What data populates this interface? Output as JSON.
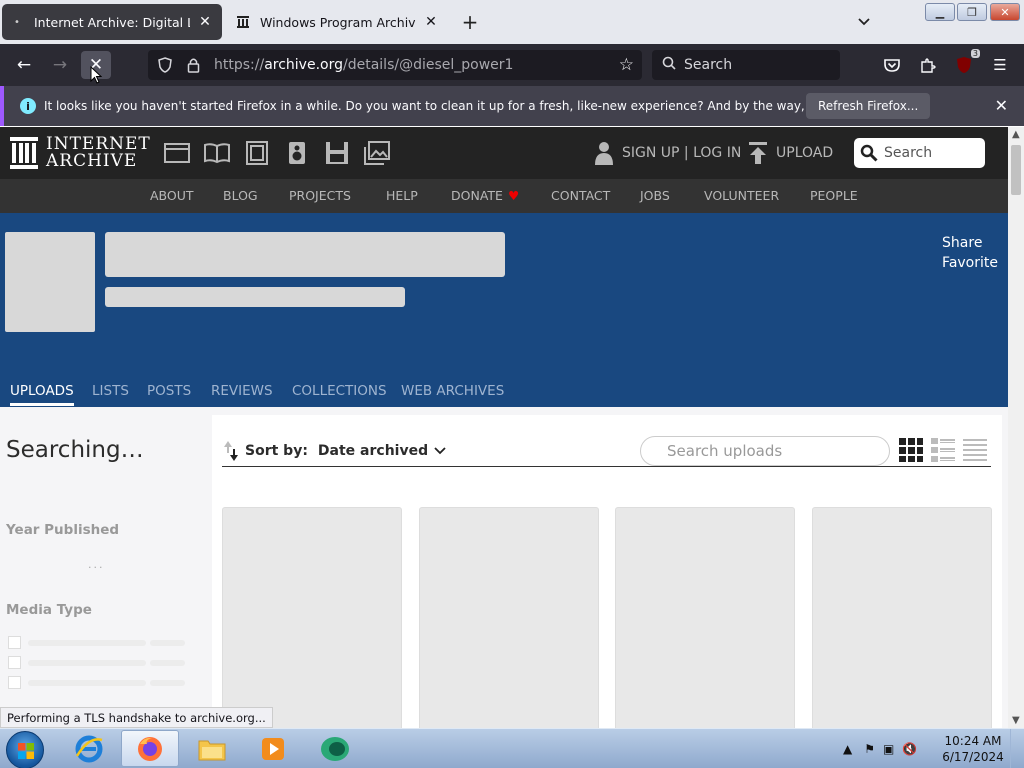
{
  "browser": {
    "tabs": [
      {
        "title": "Internet Archive: Digital Library",
        "active": true
      },
      {
        "title": "Windows Program Archive : Nir",
        "active": false
      }
    ],
    "url_prefix": "https://",
    "url_domain": "archive.org",
    "url_path": "/details/@diesel_power1",
    "search_placeholder": "Search",
    "extension_badge": "3",
    "notification": {
      "message": "It looks like you haven't started Firefox in a while. Do you want to clean it up for a fresh, like-new experience? And by the way, welcome back!",
      "button": "Refresh Firefox..."
    },
    "status_text": "Performing a TLS handshake to archive.org..."
  },
  "ia": {
    "logo_line1": "INTERNET",
    "logo_line2": "ARCHIVE",
    "signup": "SIGN UP | LOG IN",
    "upload": "UPLOAD",
    "search_placeholder": "Search",
    "nav": [
      "ABOUT",
      "BLOG",
      "PROJECTS",
      "HELP",
      "DONATE",
      "CONTACT",
      "JOBS",
      "VOLUNTEER",
      "PEOPLE"
    ],
    "share": "Share",
    "favorite": "Favorite",
    "tabs": [
      "UPLOADS",
      "LISTS",
      "POSTS",
      "REVIEWS",
      "COLLECTIONS",
      "WEB ARCHIVES"
    ],
    "active_tab": "UPLOADS",
    "searching": "Searching…",
    "facets": {
      "year": "Year Published",
      "media": "Media Type",
      "dots": "..."
    },
    "sort_label": "Sort by:",
    "sort_value": "Date archived",
    "search_uploads_placeholder": "Search uploads"
  },
  "taskbar": {
    "time": "10:24 AM",
    "date": "6/17/2024"
  },
  "colors": {
    "hero": "#194880",
    "ia_top": "#232323",
    "ia_nav": "#333333",
    "notif_accent": "#9e59ff",
    "firefox_dark": "#2b2a33"
  }
}
